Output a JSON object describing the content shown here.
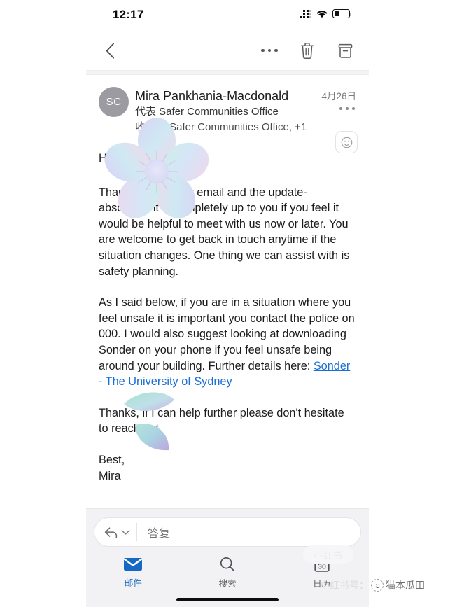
{
  "status_bar": {
    "time": "12:17",
    "cellular_icon": "cellular-bars-icon",
    "wifi_icon": "wifi-icon",
    "battery_icon": "battery-icon",
    "battery_level_percent": 36
  },
  "toolbar": {
    "back_icon": "chevron-left-icon",
    "more_icon": "more-horizontal-icon",
    "delete_icon": "trash-icon",
    "archive_icon": "archive-icon"
  },
  "message": {
    "avatar_initials": "SC",
    "sender_name": "Mira Pankhania-Macdonald",
    "on_behalf_of": "代表 Safer Communities Office",
    "recipients": "收件人 Safer Communities Office, +1",
    "date": "4月26日",
    "more_icon": "more-horizontal-icon",
    "reaction_icon": "smiley-face-icon"
  },
  "body": {
    "greeting": "Hi",
    "paragraph_1": "Thank you for your email and the update- absolutely it is completely up to you if you feel it would be helpful to meet with us now or later. You are welcome to get back in touch anytime if the situation changes. One thing we can assist with is safety planning.",
    "paragraph_2_before_link": "As I said below, if you are in a situation where you feel unsafe it is important you contact the police on 000. I would also suggest looking at downloading Sonder on your phone if you feel unsafe being around your building. Further details here: ",
    "link_text": "Sonder - The University of Sydney",
    "paragraph_3": "Thanks, if I can help further please don't hesitate to reach out.",
    "sign_off": "Best,",
    "sign_name": "Mira"
  },
  "reply": {
    "reply_icon": "reply-arrow-icon",
    "chevron_icon": "chevron-down-icon",
    "placeholder": "答复"
  },
  "tabs": [
    {
      "label": "邮件",
      "icon": "envelope-icon",
      "active": true
    },
    {
      "label": "搜索",
      "icon": "search-icon",
      "active": false
    },
    {
      "label": "日历",
      "icon": "calendar-icon",
      "active": false,
      "day": "30"
    }
  ],
  "watermark": {
    "pill_text": "小红书",
    "prefix": "小红书号：",
    "handle": "猫本瓜田",
    "badge_icon": "xiaohongshu-badge-icon"
  },
  "stickers": [
    {
      "name": "flower-sticker",
      "shape": "five-petal-flower"
    },
    {
      "name": "leaf-sticker",
      "shape": "two-leaves"
    }
  ],
  "colors": {
    "link": "#1a6fd4",
    "tab_active": "#1568c4",
    "avatar_bg": "#9b9ba1",
    "reply_bar_bg": "#f2f2f4"
  }
}
